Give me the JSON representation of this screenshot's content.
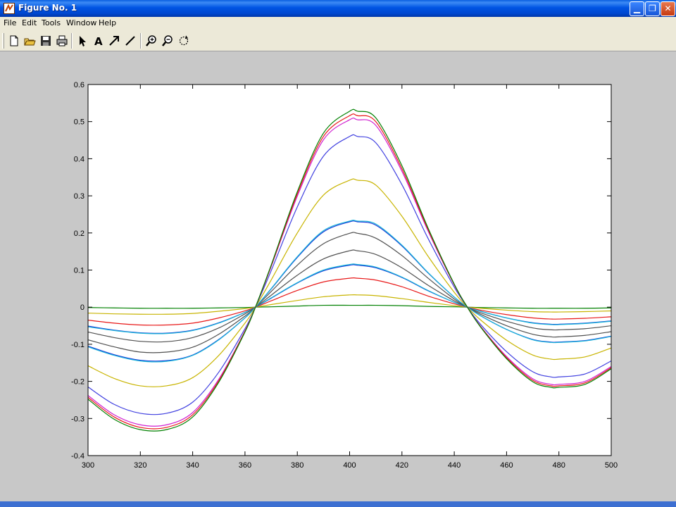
{
  "window": {
    "title": "Figure No. 1"
  },
  "menu": {
    "items": [
      "File",
      "Edit",
      "Tools",
      "Window",
      "Help"
    ]
  },
  "toolbar": {
    "tools": [
      {
        "name": "new-figure-icon"
      },
      {
        "name": "open-file-icon"
      },
      {
        "name": "save-icon"
      },
      {
        "name": "print-icon"
      },
      {
        "name": "select-arrow-icon"
      },
      {
        "name": "insert-text-icon"
      },
      {
        "name": "insert-arrow-icon"
      },
      {
        "name": "insert-line-icon"
      },
      {
        "name": "zoom-in-icon"
      },
      {
        "name": "zoom-out-icon"
      },
      {
        "name": "rotate-3d-icon"
      }
    ]
  },
  "chart_data": {
    "type": "line",
    "xlim": [
      300,
      500
    ],
    "ylim": [
      -0.4,
      0.6
    ],
    "xticks": [
      "300",
      "320",
      "340",
      "360",
      "380",
      "400",
      "420",
      "440",
      "460",
      "480",
      "500"
    ],
    "yticks": [
      "0.6",
      "0.5",
      "0.4",
      "0.3",
      "0.2",
      "0.1",
      "0",
      "-0.1",
      "-0.2",
      "-0.3",
      "-0.4"
    ],
    "grid": false,
    "x": [
      300,
      310,
      320,
      330,
      340,
      350,
      360,
      364,
      370,
      380,
      390,
      400,
      403,
      410,
      420,
      430,
      440,
      445,
      450,
      460,
      470,
      477,
      480,
      490,
      500
    ],
    "series": [
      {
        "color": "#008000",
        "values": [
          -0.001,
          -0.002,
          -0.003,
          -0.003,
          -0.003,
          -0.002,
          -0.001,
          0,
          0.001,
          0.003,
          0.005,
          0.005,
          0.005,
          0.005,
          0.004,
          0.002,
          0.001,
          0,
          -0.001,
          -0.002,
          -0.003,
          -0.003,
          -0.003,
          -0.003,
          -0.002
        ]
      },
      {
        "color": "#c8b400",
        "values": [
          -0.016,
          -0.018,
          -0.019,
          -0.019,
          -0.017,
          -0.011,
          -0.004,
          0,
          0.007,
          0.018,
          0.028,
          0.033,
          0.033,
          0.031,
          0.023,
          0.013,
          0.004,
          0,
          -0.003,
          -0.008,
          -0.012,
          -0.013,
          -0.013,
          -0.012,
          -0.01
        ]
      },
      {
        "color": "#e81818",
        "values": [
          -0.035,
          -0.043,
          -0.048,
          -0.048,
          -0.043,
          -0.029,
          -0.01,
          0,
          0.017,
          0.045,
          0.068,
          0.078,
          0.078,
          0.073,
          0.055,
          0.03,
          0.009,
          0,
          -0.008,
          -0.02,
          -0.029,
          -0.032,
          -0.032,
          -0.03,
          -0.026
        ]
      },
      {
        "color": "#1a3ad8",
        "values": [
          -0.051,
          -0.062,
          -0.069,
          -0.07,
          -0.062,
          -0.042,
          -0.014,
          0,
          0.024,
          0.065,
          0.098,
          0.113,
          0.113,
          0.106,
          0.08,
          0.044,
          0.013,
          0,
          -0.011,
          -0.029,
          -0.042,
          -0.046,
          -0.046,
          -0.043,
          -0.037
        ]
      },
      {
        "color": "#18b4d8",
        "values": [
          -0.053,
          -0.063,
          -0.07,
          -0.071,
          -0.063,
          -0.043,
          -0.014,
          0,
          0.025,
          0.066,
          0.1,
          0.115,
          0.115,
          0.108,
          0.081,
          0.045,
          0.013,
          0,
          -0.011,
          -0.029,
          -0.043,
          -0.047,
          -0.047,
          -0.044,
          -0.038
        ]
      },
      {
        "color": "#505050",
        "values": [
          -0.067,
          -0.082,
          -0.092,
          -0.093,
          -0.082,
          -0.056,
          -0.018,
          0,
          0.032,
          0.086,
          0.13,
          0.152,
          0.152,
          0.142,
          0.106,
          0.059,
          0.017,
          0,
          -0.015,
          -0.038,
          -0.056,
          -0.061,
          -0.061,
          -0.058,
          -0.05
        ]
      },
      {
        "color": "#505050",
        "values": [
          -0.088,
          -0.107,
          -0.121,
          -0.121,
          -0.108,
          -0.073,
          -0.024,
          0,
          0.042,
          0.113,
          0.171,
          0.199,
          0.199,
          0.186,
          0.139,
          0.078,
          0.022,
          0,
          -0.019,
          -0.05,
          -0.073,
          -0.08,
          -0.08,
          -0.076,
          -0.066
        ]
      },
      {
        "color": "#1a3ad8",
        "values": [
          -0.105,
          -0.128,
          -0.143,
          -0.144,
          -0.129,
          -0.087,
          -0.029,
          0,
          0.049,
          0.134,
          0.203,
          0.23,
          0.23,
          0.221,
          0.165,
          0.092,
          0.027,
          0,
          -0.023,
          -0.06,
          -0.087,
          -0.094,
          -0.094,
          -0.09,
          -0.078
        ]
      },
      {
        "color": "#18b4d8",
        "values": [
          -0.107,
          -0.13,
          -0.145,
          -0.146,
          -0.13,
          -0.088,
          -0.029,
          0,
          0.05,
          0.136,
          0.206,
          0.232,
          0.232,
          0.224,
          0.167,
          0.093,
          0.027,
          0,
          -0.023,
          -0.06,
          -0.088,
          -0.095,
          -0.095,
          -0.091,
          -0.079
        ]
      },
      {
        "color": "#c8b400",
        "values": [
          -0.158,
          -0.192,
          -0.212,
          -0.212,
          -0.19,
          -0.13,
          -0.043,
          0,
          0.073,
          0.2,
          0.302,
          0.342,
          0.342,
          0.329,
          0.245,
          0.137,
          0.04,
          0,
          -0.034,
          -0.089,
          -0.129,
          -0.14,
          -0.14,
          -0.134,
          -0.11
        ]
      },
      {
        "color": "#4040e0",
        "values": [
          -0.215,
          -0.262,
          -0.286,
          -0.286,
          -0.256,
          -0.175,
          -0.058,
          0,
          0.098,
          0.27,
          0.407,
          0.46,
          0.46,
          0.443,
          0.33,
          0.185,
          0.054,
          0,
          -0.046,
          -0.12,
          -0.174,
          -0.188,
          -0.188,
          -0.18,
          -0.145
        ]
      },
      {
        "color": "#d020d0",
        "values": [
          -0.238,
          -0.29,
          -0.317,
          -0.317,
          -0.284,
          -0.194,
          -0.064,
          0,
          0.109,
          0.299,
          0.451,
          0.505,
          0.505,
          0.49,
          0.366,
          0.205,
          0.06,
          0,
          -0.051,
          -0.133,
          -0.193,
          -0.208,
          -0.208,
          -0.2,
          -0.16
        ]
      },
      {
        "color": "#e81818",
        "values": [
          -0.243,
          -0.296,
          -0.324,
          -0.324,
          -0.29,
          -0.198,
          -0.065,
          0,
          0.111,
          0.305,
          0.46,
          0.516,
          0.516,
          0.5,
          0.373,
          0.209,
          0.061,
          0,
          -0.052,
          -0.136,
          -0.197,
          -0.212,
          -0.212,
          -0.204,
          -0.163
        ]
      },
      {
        "color": "#008000",
        "values": [
          -0.248,
          -0.302,
          -0.33,
          -0.33,
          -0.296,
          -0.202,
          -0.067,
          0,
          0.113,
          0.311,
          0.469,
          0.528,
          0.528,
          0.51,
          0.381,
          0.213,
          0.062,
          0,
          -0.053,
          -0.139,
          -0.201,
          -0.216,
          -0.216,
          -0.208,
          -0.166
        ]
      }
    ]
  }
}
